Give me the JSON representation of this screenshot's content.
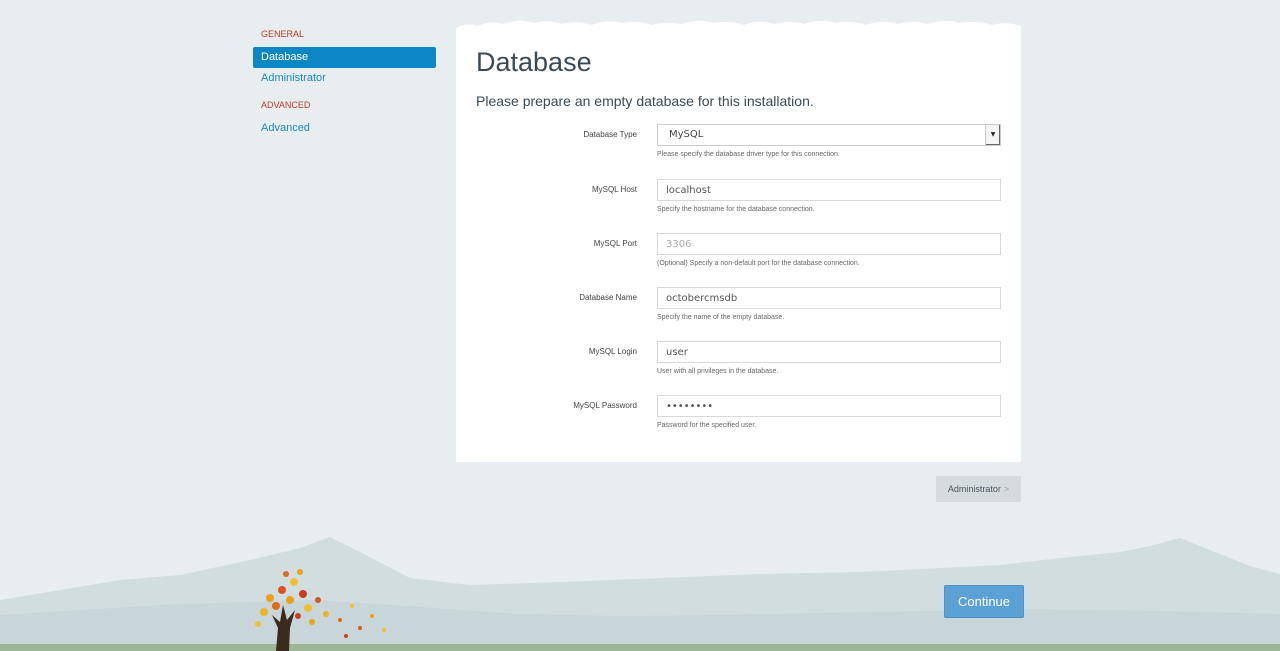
{
  "sidebar": {
    "sections": [
      {
        "title": "GENERAL",
        "items": [
          {
            "label": "Database",
            "active": true
          },
          {
            "label": "Administrator",
            "active": false
          }
        ]
      },
      {
        "title": "ADVANCED",
        "items": [
          {
            "label": "Advanced",
            "active": false
          }
        ]
      }
    ]
  },
  "panel": {
    "title": "Database",
    "subtitle": "Please prepare an empty database for this installation.",
    "fields": {
      "db_type": {
        "label": "Database Type",
        "value": "MySQL",
        "help": "Please specify the database driver type for this connection."
      },
      "host": {
        "label": "MySQL Host",
        "value": "localhost",
        "help": "Specify the hostname for the database connection."
      },
      "port": {
        "label": "MySQL Port",
        "value": "",
        "placeholder": "3306",
        "help": "(Optional) Specify a non-default port for the database connection."
      },
      "name": {
        "label": "Database Name",
        "value": "octobercmsdb",
        "help": "Specify the name of the empty database."
      },
      "login": {
        "label": "MySQL Login",
        "value": "user",
        "help": "User with all privileges in the database."
      },
      "password": {
        "label": "MySQL Password",
        "value": "password",
        "help": "Password for the specified user."
      }
    }
  },
  "buttons": {
    "next_section": "Administrator",
    "next_chevron": ">",
    "continue": "Continue"
  },
  "icons": {
    "select_arrow": "caret-down-icon",
    "tree": "autumn-tree-icon"
  },
  "colors": {
    "accent": "#0c86c4",
    "section_heading": "#c0392b",
    "continue_button": "#5ca1d6",
    "background": "#e8eeef"
  }
}
